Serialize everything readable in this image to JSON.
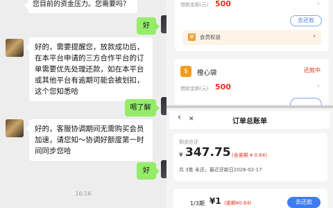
{
  "chat": {
    "messages": [
      {
        "from": "agent",
        "text": "您目前的资金压力。您需要吗？"
      },
      {
        "from": "me",
        "text": "好"
      },
      {
        "from": "agent",
        "text": "好的，需要提醒您，放款成功后，在本平台申请的三方合作平台的订单需要优先处理还款，如在本平台或其他平台有逾期可能会被划扣，这个您知悉哈"
      },
      {
        "from": "me",
        "text": "嗯了解"
      },
      {
        "from": "agent",
        "text": "好的，客服协调期间无需购买会员加速，请您知～协调好额度第一时间同步您哈"
      },
      {
        "from": "me",
        "text": "好"
      }
    ],
    "timestamp": "16:16"
  },
  "loan_list": {
    "card1": {
      "borrow_label": "借款金额(元)",
      "amount": "500",
      "button": "去还款",
      "member_label": "会员权益",
      "member_icon": "V"
    },
    "card2": {
      "name": "橙心袋",
      "logo": "$",
      "status": "还款中",
      "borrow_label": "借款金额(元)",
      "amount": "500"
    }
  },
  "order_page": {
    "title": "订单总账单",
    "back_icon": "‹",
    "close_icon": "✕",
    "remaining_label": "剩余应还",
    "amount": "347.75",
    "currency": "¥",
    "overdue_note": "(含逾期 ¥ 0.64)",
    "summary": "共 3笔 未还，最近还款日2026-02-17",
    "installment": "1/3期",
    "installment_amount": "¥1",
    "installment_note": "(逾期¥0.64)",
    "pay_button": "去还款"
  },
  "colors": {
    "accent_red": "#e0301e",
    "accent_blue": "#3d7bf0",
    "chat_green": "#95ec69"
  }
}
